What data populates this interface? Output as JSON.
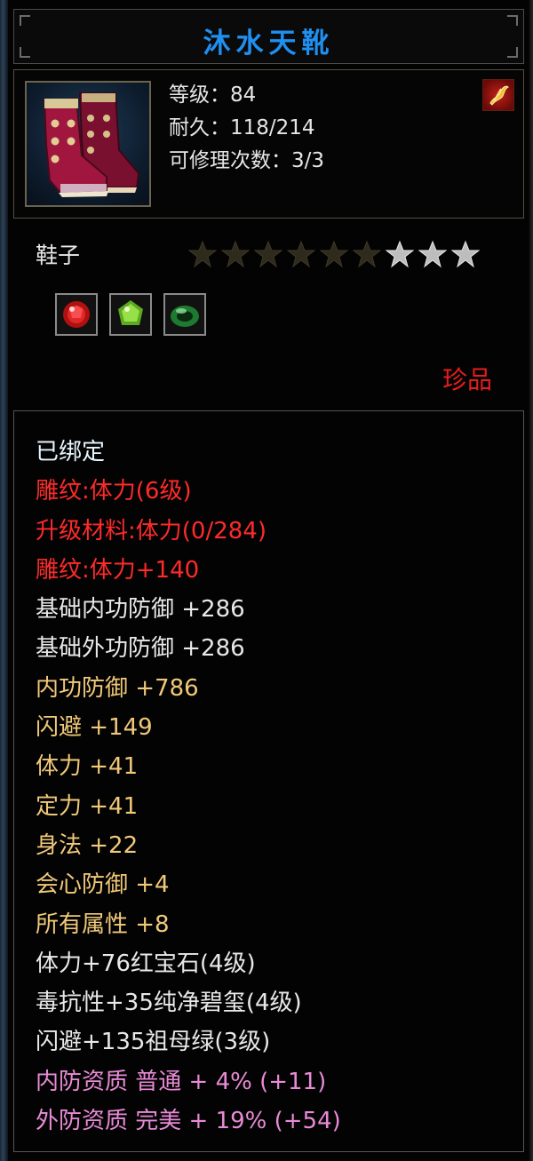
{
  "item": {
    "name": "沐水天靴",
    "level_line": "等级：84",
    "durability_line": "耐久：118/214",
    "repair_line": "可修理次数：3/3",
    "type": "鞋子",
    "stars_total": 9,
    "stars_lit": 3,
    "rarity": "珍品",
    "gems": [
      {
        "name": "ruby-gem-icon",
        "color": "#d11a1a"
      },
      {
        "name": "peridot-gem-icon",
        "color": "#7fd13a"
      },
      {
        "name": "jade-ring-gem-icon",
        "color": "#2fa84a"
      }
    ],
    "badge_icon": "weapon-mark-icon"
  },
  "colors": {
    "title": "#1f8ff0",
    "white": "#e8e8e8",
    "red": "#ff2a2a",
    "gold": "#f0c878",
    "yellow": "#f2e64a",
    "pink": "#e98ad6",
    "bound": "#e8f6ff"
  },
  "attributes": [
    {
      "text": "已绑定",
      "color": "bound"
    },
    {
      "text": "雕纹:体力(6级)",
      "color": "red"
    },
    {
      "text": "升级材料:体力(0/284)",
      "color": "red"
    },
    {
      "text": "雕纹:体力+140",
      "color": "red"
    },
    {
      "text": "基础内功防御 +286",
      "color": "white"
    },
    {
      "text": "基础外功防御 +286",
      "color": "white"
    },
    {
      "text": "内功防御 +786",
      "color": "gold"
    },
    {
      "text": "闪避 +149",
      "color": "gold"
    },
    {
      "text": "体力 +41",
      "color": "gold"
    },
    {
      "text": "定力 +41",
      "color": "gold"
    },
    {
      "text": "身法 +22",
      "color": "gold"
    },
    {
      "text": "会心防御 +4",
      "color": "gold"
    },
    {
      "text": "所有属性 +8",
      "color": "gold"
    },
    {
      "text": "体力+76红宝石(4级)",
      "color": "white"
    },
    {
      "text": "毒抗性+35纯净碧玺(4级)",
      "color": "white"
    },
    {
      "text": "闪避+135祖母绿(3级)",
      "color": "white"
    },
    {
      "text": "内防资质 普通 + 4% (+11)",
      "color": "pink"
    },
    {
      "text": "外防资质 完美 + 19% (+54)",
      "color": "pink"
    }
  ]
}
